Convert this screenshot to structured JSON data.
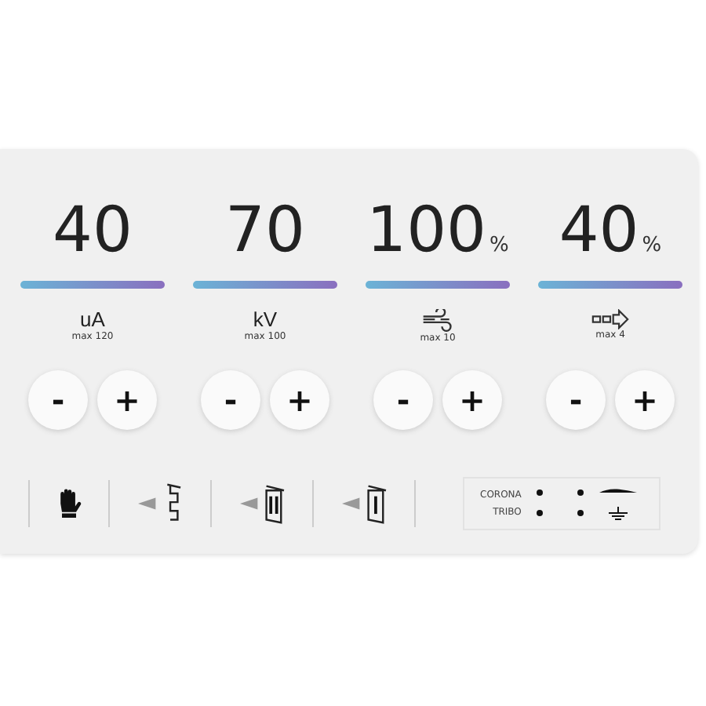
{
  "channels": [
    {
      "value": "40",
      "kind": "text",
      "unit": "uA",
      "max": "max 120",
      "minus": "-",
      "plus": "+"
    },
    {
      "value": "70",
      "kind": "text",
      "unit": "kV",
      "max": "max 100",
      "minus": "-",
      "plus": "+"
    },
    {
      "value": "100",
      "suffix": "%",
      "kind": "airflow",
      "max": "max 10",
      "minus": "-",
      "plus": "+"
    },
    {
      "value": "40",
      "suffix": "%",
      "kind": "spray",
      "max": "max 4",
      "minus": "-",
      "plus": "+"
    }
  ],
  "modes": [
    {
      "kind": "hand"
    },
    {
      "kind": "comb"
    },
    {
      "kind": "double"
    },
    {
      "kind": "single"
    }
  ],
  "charge": {
    "corona": "CORONA",
    "tribo": "TRIBO"
  }
}
